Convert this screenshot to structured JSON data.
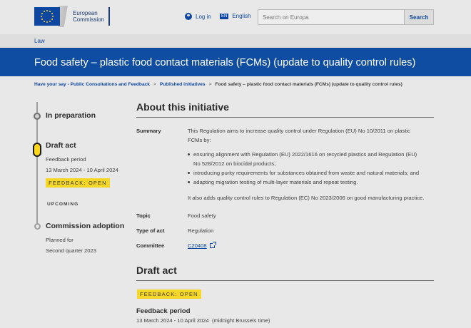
{
  "header": {
    "logo_line1": "European",
    "logo_line2": "Commission",
    "login_label": "Log in",
    "language_code": "EN",
    "language_label": "English",
    "search_placeholder": "Search on Europa",
    "search_button": "Search"
  },
  "nav": {
    "law_link": "Law"
  },
  "page_title": "Food safety – plastic food contact materials (FCMs) (update to quality control rules)",
  "breadcrumb": [
    "Have your say - Public Consultations and Feedback",
    "Published initiatives",
    "Food safety – plastic food contact materials (FCMs) (update to quality control rules)"
  ],
  "timeline": {
    "stage1_title": "In preparation",
    "stage2_title": "Draft act",
    "stage2_period_label": "Feedback period",
    "stage2_dates": "13 March 2024 - 10 April 2024",
    "stage2_badge": "FEEDBACK: OPEN",
    "upcoming_label": "UPCOMING",
    "stage3_title": "Commission adoption",
    "stage3_planned": "Planned for",
    "stage3_when": "Second quarter 2023"
  },
  "about": {
    "heading": "About this initiative",
    "summary_label": "Summary",
    "summary_intro_1": "This Regulation aims to increase quality control under Regulation (EU) No 10/2011 on plastic",
    "summary_intro_2": "FCMs by:",
    "bullets": [
      "ensuring alignment with Regulation (EU) 2022/1616 on recycled plastics and Regulation (EU)",
      "No 528/2012 on biocidal products;",
      "introducing purity requirements for substances obtained from waste and natural materials; and",
      "adapting migration testing of multi-layer materials and repeat testing."
    ],
    "summary_outro": "It also adds quality control rules to Regulation (EC) No 2023/2006 on good manufacturing practice.",
    "topic_label": "Topic",
    "topic_value": "Food safety",
    "type_label": "Type of act",
    "type_value": "Regulation",
    "committee_label": "Committee",
    "committee_value": "C20408"
  },
  "draft_act": {
    "heading": "Draft act",
    "badge": "FEEDBACK: OPEN",
    "period_heading": "Feedback period",
    "period_value": "13 March 2024 - 10 April 2024  (midnight Brussels time)"
  },
  "colors": {
    "brand_blue": "#0f4da2",
    "badge_yellow": "#f6d626"
  }
}
